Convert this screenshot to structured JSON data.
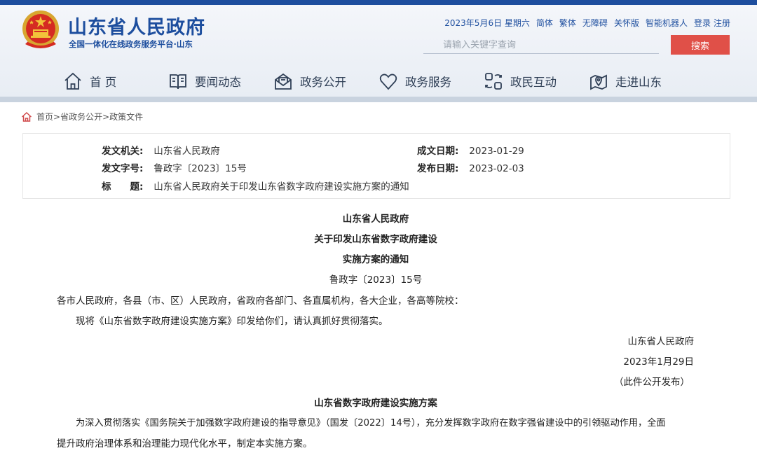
{
  "site": {
    "title": "山东省人民政府",
    "subtitle": "全国一体化在线政务服务平台·山东"
  },
  "toplinks": {
    "date": "2023年5月6日 星期六",
    "simplified": "简体",
    "traditional": "繁体",
    "accessible": "无障碍",
    "care": "关怀版",
    "robot": "智能机器人",
    "login": "登录",
    "register": "注册"
  },
  "search": {
    "placeholder": "请输入关键字查询",
    "button": "搜索"
  },
  "nav": {
    "home": "首 页",
    "news": "要闻动态",
    "open": "政务公开",
    "service": "政务服务",
    "interact": "政民互动",
    "about": "走进山东"
  },
  "breadcrumb": {
    "home": "首页",
    "level1": "省政务公开",
    "level2": "政策文件",
    "separator": ">"
  },
  "meta": {
    "issuer_label": "发文机关:",
    "issuer": "山东省人民政府",
    "doc_no_label": "发文字号:",
    "doc_no": "鲁政字〔2023〕15号",
    "title_label": "标　　题:",
    "title": "山东省人民政府关于印发山东省数字政府建设实施方案的通知",
    "written_label": "成文日期:",
    "written": "2023-01-29",
    "published_label": "发布日期:",
    "published": "2023-02-03"
  },
  "doc": {
    "head1": "山东省人民政府",
    "head2": "关于印发山东省数字政府建设",
    "head3": "实施方案的通知",
    "doc_no": "鲁政字〔2023〕15号",
    "recipients": "各市人民政府，各县（市、区）人民政府，省政府各部门、各直属机构，各大企业，各高等院校：",
    "body": "现将《山东省数字政府建设实施方案》印发给你们，请认真抓好贯彻落实。",
    "sign": "山东省人民政府",
    "date": "2023年1月29日",
    "note": "（此件公开发布）",
    "plan_title": "山东省数字政府建设实施方案",
    "para1": "为深入贯彻落实《国务院关于加强数字政府建设的指导意见》（国发〔2022〕14号），充分发挥数字政府在数字强省建设中的引领驱动作用，全面",
    "para2": "提升政府治理体系和治理能力现代化水平，制定本实施方案。"
  },
  "colors": {
    "brand_blue": "#1d4e9e",
    "search_red": "#e05048",
    "nav_text": "#2f3f56"
  }
}
